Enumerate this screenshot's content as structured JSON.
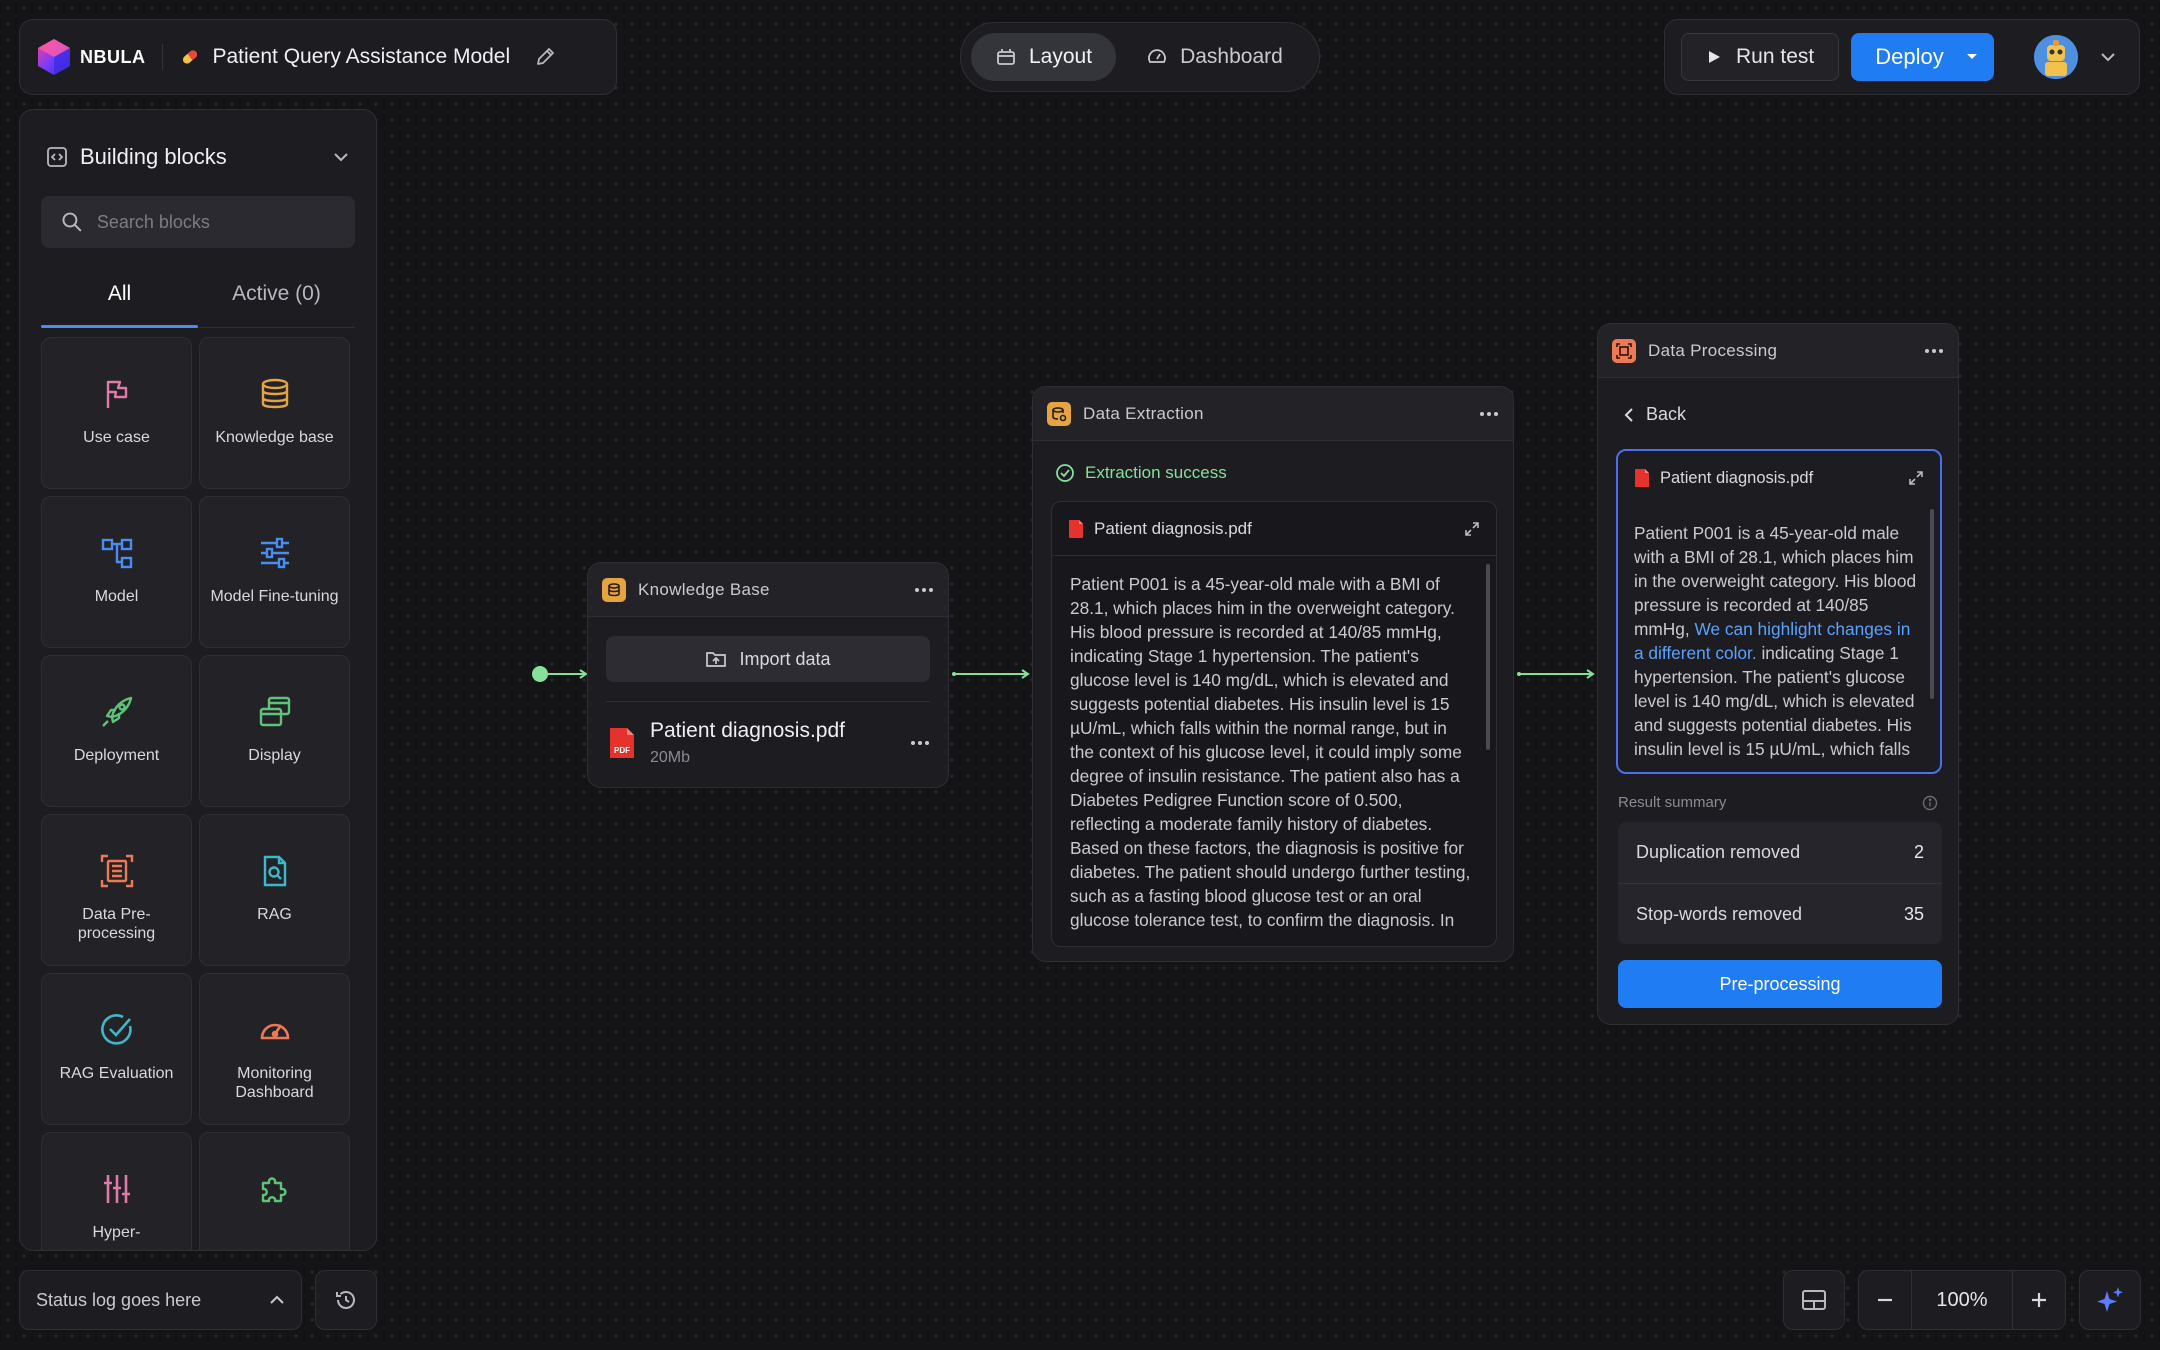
{
  "brand": {
    "logo_text": "NBULA"
  },
  "project": {
    "title": "Patient Query Assistance Model"
  },
  "view_switch": {
    "layout": "Layout",
    "dashboard": "Dashboard"
  },
  "actions": {
    "run_test": "Run test",
    "deploy": "Deploy"
  },
  "sidebar": {
    "title": "Building blocks",
    "search_placeholder": "Search blocks",
    "tabs": {
      "all": "All",
      "active": "Active (0)"
    },
    "blocks": [
      {
        "label": "Use case",
        "icon": "flag-icon",
        "color": "#e07aa8"
      },
      {
        "label": "Knowledge base",
        "icon": "database-icon",
        "color": "#e6a341"
      },
      {
        "label": "Model",
        "icon": "hierarchy-icon",
        "color": "#4a8cf0"
      },
      {
        "label": "Model Fine-tuning",
        "icon": "sliders-icon",
        "color": "#4a8cf0"
      },
      {
        "label": "Deployment",
        "icon": "rocket-icon",
        "color": "#5fc47a"
      },
      {
        "label": "Display",
        "icon": "windows-icon",
        "color": "#5fc47a"
      },
      {
        "label": "Data Pre-processing",
        "icon": "document-scan-icon",
        "color": "#ee7a55"
      },
      {
        "label": "RAG",
        "icon": "document-search-icon",
        "color": "#3fb6c9"
      },
      {
        "label": "RAG Evaluation",
        "icon": "check-circle-icon",
        "color": "#3fb6c9"
      },
      {
        "label": "Monitoring Dashboard",
        "icon": "gauge-icon",
        "color": "#ee7a55"
      },
      {
        "label": "Hyper-",
        "icon": "vertical-sliders-icon",
        "color": "#e07aa8"
      },
      {
        "label": "",
        "icon": "puzzle-icon",
        "color": "#5fc47a"
      }
    ]
  },
  "status_log": {
    "text": "Status log goes here"
  },
  "zoom": {
    "value": "100%"
  },
  "nodes": {
    "knowledge_base": {
      "title": "Knowledge Base",
      "import_label": "Import data",
      "file": {
        "name": "Patient diagnosis.pdf",
        "size": "20Mb"
      }
    },
    "data_extraction": {
      "title": "Data Extraction",
      "status": "Extraction success",
      "file_name": "Patient diagnosis.pdf",
      "text": "Patient P001 is a 45-year-old male with a BMI of 28.1, which places him in the overweight category. His blood pressure is recorded at 140/85 mmHg, indicating Stage 1 hypertension. The patient's glucose level is 140 mg/dL, which is elevated and suggests potential diabetes. His insulin level is 15 µU/mL, which falls within the normal range, but in the context of his glucose level, it could imply some degree of insulin resistance. The patient also has a Diabetes Pedigree Function score of 0.500, reflecting a moderate family history of diabetes. Based on these factors, the diagnosis is positive for diabetes. The patient should undergo further testing, such as a fasting blood glucose test or an oral glucose tolerance test, to confirm the diagnosis. In addition, lifestyle changes are"
    },
    "data_processing": {
      "title": "Data Processing",
      "back_label": "Back",
      "file_name": "Patient diagnosis.pdf",
      "text_before": "Patient P001 is a 45-year-old male with a BMI of 28.1, which places him in the overweight category. His blood pressure is recorded at 140/85 mmHg, ",
      "text_highlight": "We can highlight changes in a different color.",
      "text_after": " indicating Stage 1 hypertension. The patient's glucose level is 140 mg/dL, which is elevated and suggests potential diabetes. His insulin level is 15 µU/mL, which falls",
      "highlight_color": "#5aa2ff",
      "result_summary_label": "Result summary",
      "results": [
        {
          "label": "Duplication removed",
          "value": "2"
        },
        {
          "label": "Stop-words removed",
          "value": "35"
        }
      ],
      "action_label": "Pre-processing"
    }
  },
  "colors": {
    "background": "#141417",
    "panel": "#1c1c21",
    "accent_blue": "#1f7cf2",
    "success_green": "#86e09a"
  }
}
